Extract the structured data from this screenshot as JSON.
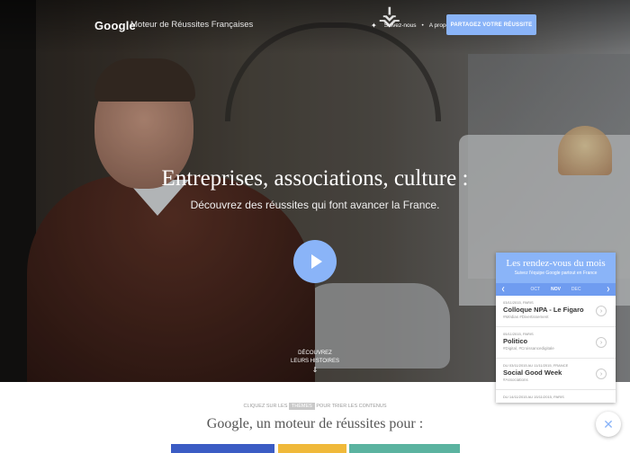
{
  "header": {
    "logo": "Google",
    "subtitle": "Moteur de Réussites Françaises",
    "follow": "Suivez-nous",
    "about": "A propos",
    "cta": "PARTAGEZ VOTRE RÉUSSITE"
  },
  "hero": {
    "headline": "Entreprises, associations, culture :",
    "subline": "Découvrez des réussites qui font avancer la France.",
    "discover_line1": "DÉCOUVREZ",
    "discover_line2": "LEURS HISTOIRES"
  },
  "panel": {
    "title": "Les rendez-vous du mois",
    "subtitle": "Suivez l'équipe Google partout en France",
    "months": [
      "OCT",
      "NOV",
      "DEC"
    ],
    "active_month": "NOV",
    "events": [
      {
        "date": "03/11/2015, PARIS",
        "name": "Colloque NPA - Le Figaro",
        "tags": "#Médias #Divertissement"
      },
      {
        "date": "05/11/2015, PARIS",
        "name": "Politico",
        "tags": "#Digital, #Croissancedigitale"
      },
      {
        "date": "DU 03/11/2015 AU 11/11/2015, FRANCE",
        "name": "Social Good Week",
        "tags": "#Associations"
      },
      {
        "date": "DU 14/11/2015 AU 15/11/2015, PARIS",
        "name": "",
        "tags": ""
      }
    ]
  },
  "lower": {
    "hint_before": "CLIQUEZ SUR LES",
    "hint_theme": "THÈMES",
    "hint_after": "POUR TRIER LES CONTENUS",
    "title": "Google, un moteur de réussites pour :"
  },
  "colors": {
    "accent": "#8ab4f8",
    "chip1": "#3b5cc4",
    "chip2": "#f0b93a",
    "chip3": "#5bb3a0"
  }
}
